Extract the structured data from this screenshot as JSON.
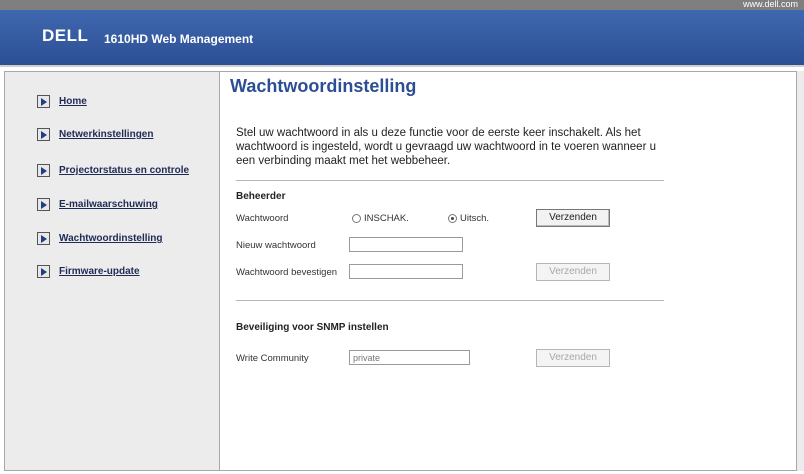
{
  "header": {
    "url": "www.dell.com",
    "logo": "DELL",
    "app_title": "1610HD Web Management"
  },
  "sidebar": {
    "items": [
      {
        "label": "Home"
      },
      {
        "label": "Netwerkinstellingen"
      },
      {
        "label": "Projectorstatus en controle"
      },
      {
        "label": "E-mailwaarschuwing"
      },
      {
        "label": "Wachtwoordinstelling"
      },
      {
        "label": "Firmware-update"
      }
    ]
  },
  "main": {
    "title": "Wachtwoordinstelling",
    "intro": "Stel uw wachtwoord in als u deze functie voor de eerste keer inschakelt. Als het wachtwoord is ingesteld, wordt u gevraagd uw wachtwoord in te voeren wanneer u een verbinding maakt met het webbeheer.",
    "admin": {
      "section_title": "Beheerder",
      "password_label": "Wachtwoord",
      "radio_on": "INSCHAK.",
      "radio_off": "Uitsch.",
      "selected": "Uitsch.",
      "submit1": "Verzenden",
      "new_password_label": "Nieuw wachtwoord",
      "new_password_value": "",
      "confirm_label": "Wachtwoord bevestigen",
      "confirm_value": "",
      "submit2": "Verzenden"
    },
    "snmp": {
      "section_title": "Beveiliging voor SNMP instellen",
      "community_label": "Write Community",
      "community_placeholder": "private",
      "submit": "Verzenden"
    }
  }
}
